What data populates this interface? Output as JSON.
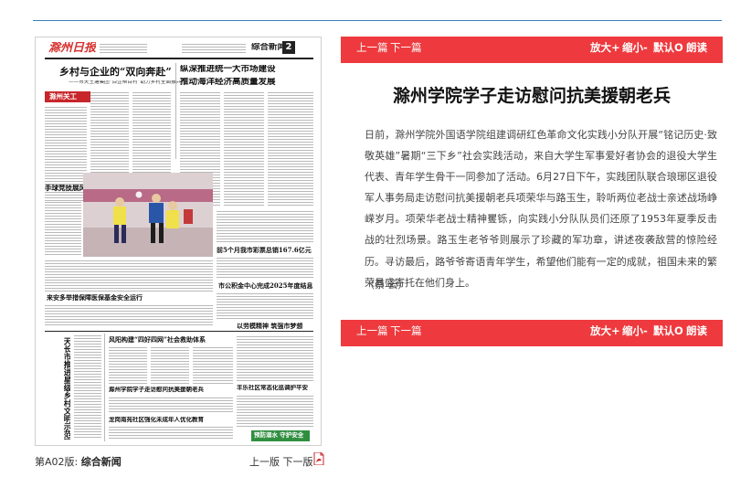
{
  "paper": {
    "masthead": "滁州日报",
    "section": "综合新闻",
    "page_number": "2",
    "lead_title": "乡村与企业的“双向奔赴”",
    "lead_subtitle": "——市天王塘集团“百企帮百村”助力乡村全面振兴",
    "feature_label": "滁州关工",
    "right_title_1": "纵深推进统一大市场建设",
    "right_title_2": "推动海洋经济高质量发展",
    "photo_caption": "手球竞技展风采",
    "mid_head_1": "前5个月我市彩票总销167.6亿元",
    "mid_head_2": "市公积金中心完成2025年度结息",
    "section_head": "来安多举措保障医保基金安全运行",
    "vertical_head": "天长市推进星级乡村文明示范建设",
    "center_head_1": "风阳构建“四好四网”社会救助体系",
    "center_head_2": "以劳模精神 筑强市梦想",
    "center_head_3": "滁州学院学子走访慰问抗美援朝老兵",
    "center_head_4": "龙岗南苑社区强化未成年人优化教育",
    "center_head_5": "丰乐社区常态化巡调护平安",
    "ad_text": "预防溺水 守护安全"
  },
  "nav": {
    "prev_article": "上一篇",
    "next_article": "下一篇",
    "zoom_in": "放大+",
    "zoom_out": "缩小-",
    "reset": "默认O",
    "read_aloud": "朗读"
  },
  "article": {
    "title": "滁州学院学子走访慰问抗美援朝老兵",
    "body": "日前，滁州学院外国语学院组建调研红色革命文化实践小分队开展“铭记历史·致敬英雄”暑期“三下乡”社会实践活动，来自大学生军事爱好者协会的退役大学生代表、青年学生骨干一同参加了活动。6月27日下午，实践团队联合琅琊区退役军人事务局走访慰问抗美援朝老兵项荣华与路玉生，聆听两位老战士亲述战场峥嵘岁月。项荣华老战士精神矍铄，向实践小分队队员们还原了1953年夏季反击战的壮烈场景。路玉生老爷爷则展示了珍藏的军功章，讲述夜袭敌营的惊险经历。寻访最后，路爷爷寄语青年学生，希望他们能有一定的成就，祖国未来的繁荣昌盛寄托在他们身上。",
    "author": "（蔡 云）"
  },
  "footer": {
    "edition_prefix": "第A02版:",
    "edition_name": "综合新闻",
    "prev_page": "上一版",
    "next_page": "下一版"
  },
  "colors": {
    "accent_red": "#ee3a3e",
    "top_rule_blue": "#3f7fbf",
    "paper_red": "#d6322f",
    "feature_red": "#c8262a",
    "ad_green": "#2f8f3f"
  },
  "icons": {
    "pdf": "pdf-icon"
  }
}
